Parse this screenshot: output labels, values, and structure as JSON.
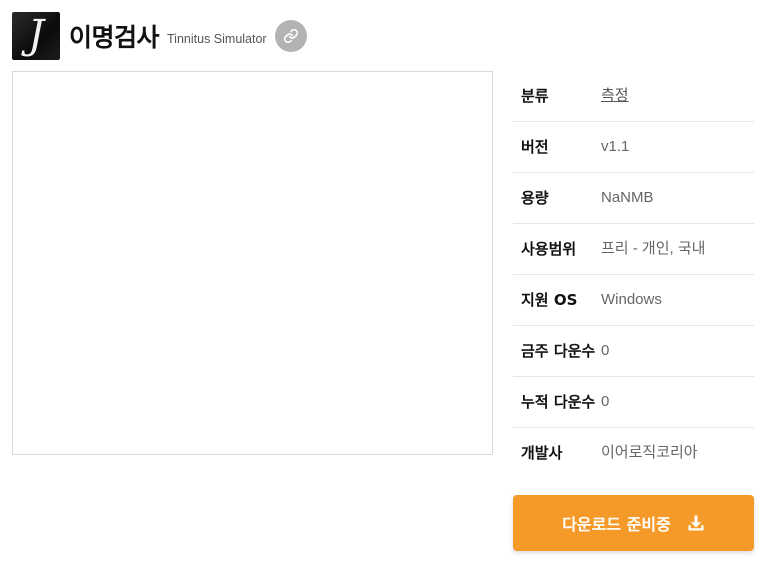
{
  "app": {
    "logo_letter": "J",
    "title": "이명검사",
    "subtitle": "Tinnitus Simulator"
  },
  "info": [
    {
      "label": "분류",
      "value": "측정"
    },
    {
      "label": "버전",
      "value": "v1.1"
    },
    {
      "label": "용량",
      "value": "NaNMB"
    },
    {
      "label": "사용범위",
      "value": "프리 - 개인, 국내"
    },
    {
      "label": "지원 OS",
      "value": "Windows"
    },
    {
      "label": "금주 다운수",
      "value": "0"
    },
    {
      "label": "누적 다운수",
      "value": "0"
    },
    {
      "label": "개발사",
      "value": "이어로직코리아"
    }
  ],
  "download": {
    "label": "다운로드 준비중"
  },
  "icons": {
    "link": "link-icon",
    "download": "download-icon"
  },
  "colors": {
    "accent": "#f59a28",
    "link_button": "#b3b3b3"
  }
}
